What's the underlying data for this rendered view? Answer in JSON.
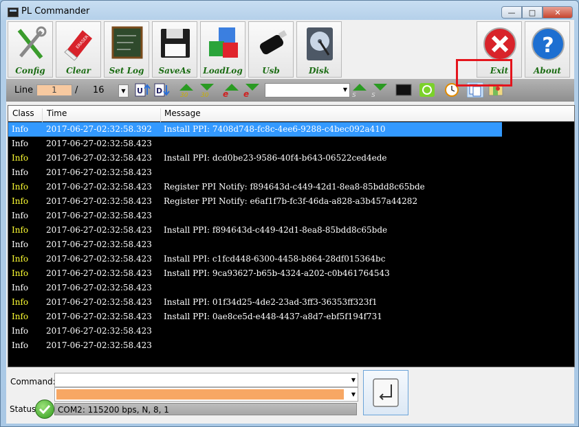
{
  "window": {
    "title": "PL Commander"
  },
  "toolbar": {
    "buttons": [
      {
        "label": "Config"
      },
      {
        "label": "Clear"
      },
      {
        "label": "Set Log"
      },
      {
        "label": "SaveAs"
      },
      {
        "label": "LoadLog"
      },
      {
        "label": "Usb"
      },
      {
        "label": "Disk"
      },
      {
        "label": "Exit"
      },
      {
        "label": "About"
      }
    ]
  },
  "navbar": {
    "line_label": "Line",
    "line_value": "1",
    "separator": "/",
    "total": "16",
    "ico_30": "30"
  },
  "log": {
    "columns": [
      "Class",
      "Time",
      "Message"
    ],
    "rows": [
      {
        "class": "Info",
        "time": "2017-06-27-02:32:58.392",
        "message": "Install PPI: 7408d748-fc8c-4ee6-9288-c4bec092a410",
        "level": "yellow",
        "selected": true
      },
      {
        "class": "Info",
        "time": "2017-06-27-02:32:58.423",
        "message": "",
        "level": "white"
      },
      {
        "class": "Info",
        "time": "2017-06-27-02:32:58.423",
        "message": "Install PPI: dcd0be23-9586-40f4-b643-06522ced4ede",
        "level": "yellow"
      },
      {
        "class": "Info",
        "time": "2017-06-27-02:32:58.423",
        "message": "",
        "level": "white"
      },
      {
        "class": "Info",
        "time": "2017-06-27-02:32:58.423",
        "message": "Register PPI Notify: f894643d-c449-42d1-8ea8-85bdd8c65bde",
        "level": "yellow"
      },
      {
        "class": "Info",
        "time": "2017-06-27-02:32:58.423",
        "message": "Register PPI Notify: e6af1f7b-fc3f-46da-a828-a3b457a44282",
        "level": "yellow"
      },
      {
        "class": "Info",
        "time": "2017-06-27-02:32:58.423",
        "message": "",
        "level": "white"
      },
      {
        "class": "Info",
        "time": "2017-06-27-02:32:58.423",
        "message": "Install PPI: f894643d-c449-42d1-8ea8-85bdd8c65bde",
        "level": "yellow"
      },
      {
        "class": "Info",
        "time": "2017-06-27-02:32:58.423",
        "message": "",
        "level": "white"
      },
      {
        "class": "Info",
        "time": "2017-06-27-02:32:58.423",
        "message": "Install PPI: c1fcd448-6300-4458-b864-28df015364bc",
        "level": "yellow"
      },
      {
        "class": "Info",
        "time": "2017-06-27-02:32:58.423",
        "message": "Install PPI: 9ca93627-b65b-4324-a202-c0b461764543",
        "level": "yellow"
      },
      {
        "class": "Info",
        "time": "2017-06-27-02:32:58.423",
        "message": "",
        "level": "white"
      },
      {
        "class": "Info",
        "time": "2017-06-27-02:32:58.423",
        "message": "Install PPI: 01f34d25-4de2-23ad-3ff3-36353ff323f1",
        "level": "yellow"
      },
      {
        "class": "Info",
        "time": "2017-06-27-02:32:58.423",
        "message": "Install PPI: 0ae8ce5d-e448-4437-a8d7-ebf5f194f731",
        "level": "yellow"
      },
      {
        "class": "Info",
        "time": "2017-06-27-02:32:58.423",
        "message": "",
        "level": "white"
      },
      {
        "class": "Info",
        "time": "2017-06-27-02:32:58.423",
        "message": "",
        "level": "white"
      }
    ]
  },
  "command": {
    "label": "Command:",
    "value": ""
  },
  "status": {
    "label": "Status",
    "text": "COM2: 115200 bps, N, 8, 1"
  },
  "colors": {
    "info_yellow": "#ffff33",
    "info_white": "#ffffff",
    "selection": "#3399ff",
    "highlight_box": "#e4141c"
  }
}
